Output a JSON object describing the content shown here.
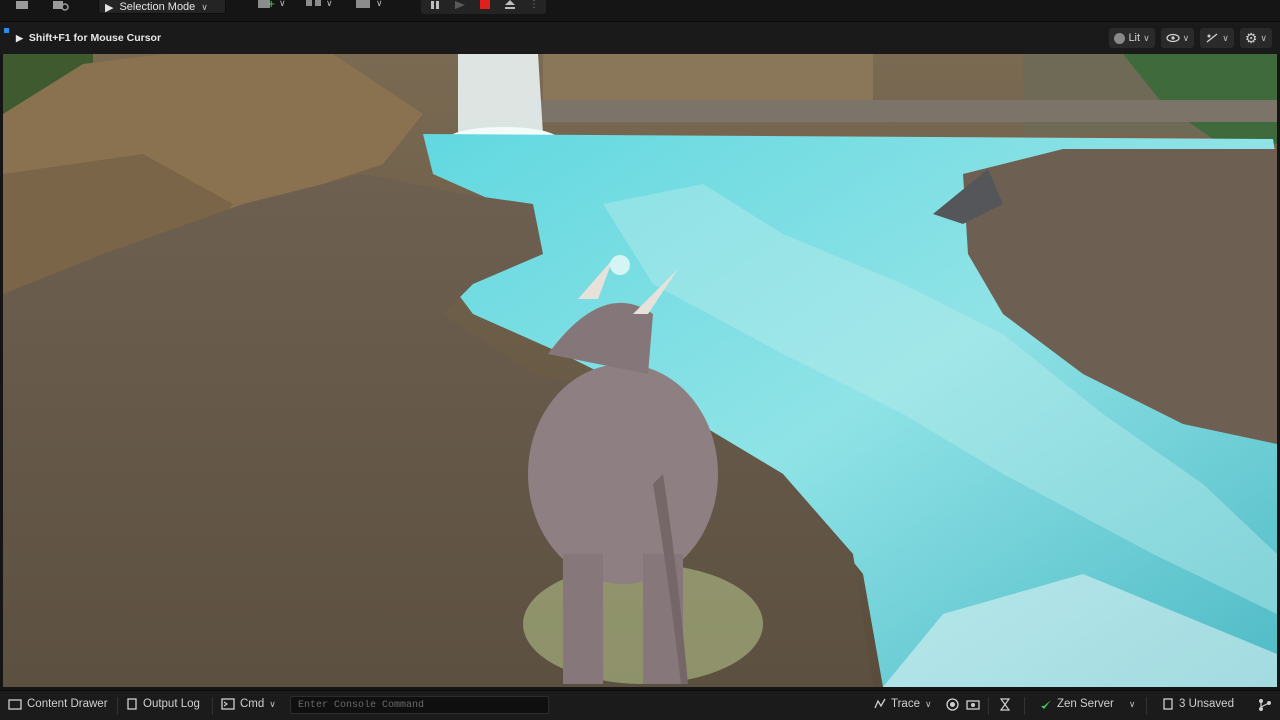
{
  "toolbar": {
    "selection_mode_label": "Selection Mode"
  },
  "viewport_toolbar": {
    "hint": "Shift+F1 for Mouse Cursor",
    "view_mode_label": "Lit"
  },
  "bottom_bar": {
    "content_drawer": "Content Drawer",
    "output_log": "Output Log",
    "cmd": "Cmd",
    "console_placeholder": "Enter Console Command",
    "trace": "Trace",
    "zen_server": "Zen Server",
    "unsaved": "3 Unsaved"
  },
  "colors": {
    "water": "#5fd3dc",
    "ground": "#6b5d4e",
    "stop_button": "#e0201e",
    "zen_green": "#3fcf55"
  },
  "icons": [
    "save-icon",
    "browse-icon",
    "cursor-icon",
    "add-actor-icon",
    "blueprint-icon",
    "cinematics-icon",
    "pause-icon",
    "play-icon",
    "stop-icon",
    "eject-icon",
    "lit-icon",
    "eye-icon",
    "snap-icon",
    "settings-icon",
    "folder-icon",
    "log-icon",
    "terminal-icon",
    "trace-icon",
    "record-icon",
    "camera-icon",
    "hourglass-icon",
    "zen-icon",
    "unsaved-icon",
    "source-control-icon"
  ]
}
